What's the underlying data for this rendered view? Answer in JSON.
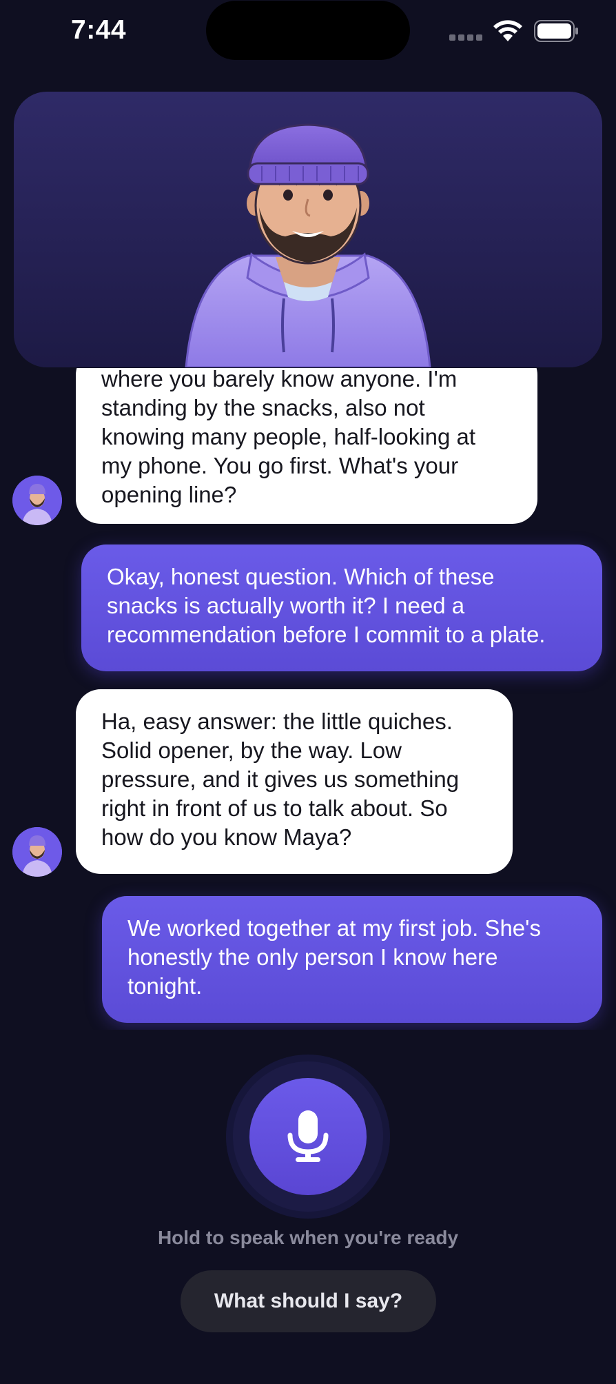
{
  "status_bar": {
    "time": "7:44"
  },
  "hero": {
    "avatar_icon": "host-avatar-illustration"
  },
  "messages": [
    {
      "role": "assistant",
      "text": "where you barely know anyone. I'm\nstanding by the snacks, also not\nknowing many people, half-looking at\nmy phone. You go first. What's your\nopening line?"
    },
    {
      "role": "user",
      "text": "Okay, honest question. Which of these\nsnacks is actually worth it? I need a\nrecommendation before I commit to a plate."
    },
    {
      "role": "assistant",
      "text": "Ha, easy answer: the little quiches.\nSolid opener, by the way. Low\npressure, and it gives us something\nright in front of us to talk about. So\nhow do you know Maya?"
    },
    {
      "role": "user",
      "text": "We worked together at my first job. She's\nhonestly the only person I know here\ntonight."
    }
  ],
  "controls": {
    "mic_icon": "microphone-icon",
    "hint": "Hold to speak when you're ready",
    "suggest_button": "What should I say?"
  },
  "colors": {
    "background": "#0f0f21",
    "accent": "#6a5be8",
    "bot_bubble": "#ffffff",
    "hero_top": "#2f2a67"
  }
}
